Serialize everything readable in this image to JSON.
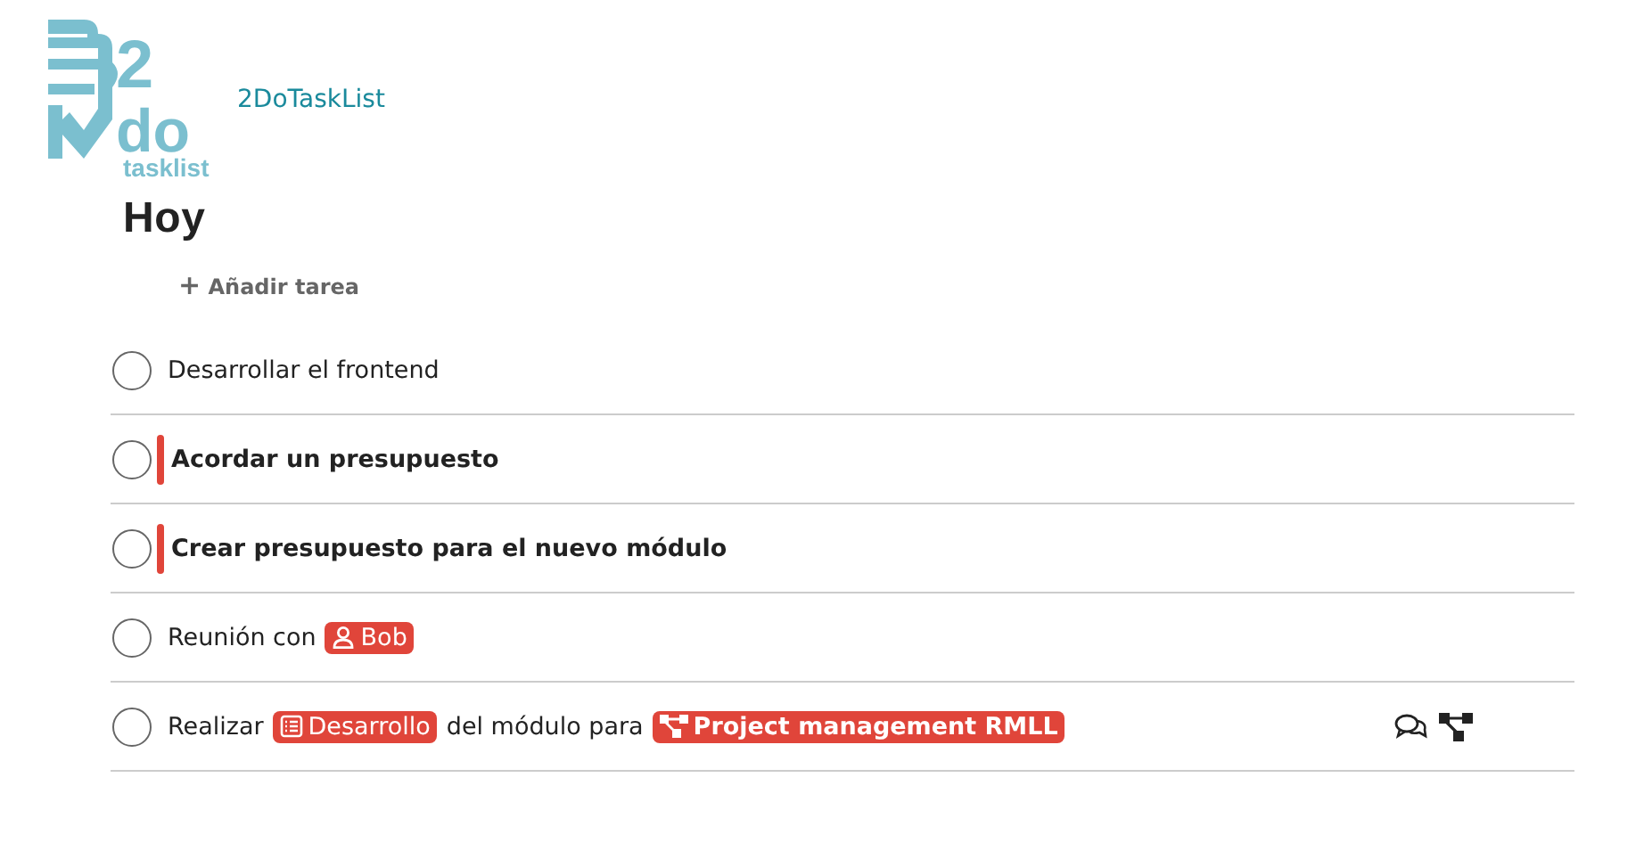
{
  "logo": {
    "numeral": "2",
    "word": "do",
    "caption": "tasklist"
  },
  "app_name": "2DoTaskList",
  "heading": "Hoy",
  "add_task": {
    "icon": "+",
    "label": "Añadir tarea"
  },
  "tasks": [
    {
      "checked": false,
      "priority": false,
      "comments": false,
      "subtasks": false,
      "parts": [
        {
          "kind": "text",
          "text": "Desarrollar el frontend"
        }
      ]
    },
    {
      "checked": false,
      "priority": true,
      "comments": false,
      "subtasks": false,
      "parts": [
        {
          "kind": "text",
          "text": "Acordar un presupuesto"
        }
      ]
    },
    {
      "checked": false,
      "priority": true,
      "comments": false,
      "subtasks": false,
      "parts": [
        {
          "kind": "text",
          "text": "Crear presupuesto para el nuevo módulo"
        }
      ]
    },
    {
      "checked": false,
      "priority": false,
      "comments": false,
      "subtasks": false,
      "parts": [
        {
          "kind": "text",
          "text": "Reunión con"
        },
        {
          "kind": "person",
          "text": "Bob"
        }
      ]
    },
    {
      "checked": false,
      "priority": false,
      "comments": true,
      "subtasks": true,
      "parts": [
        {
          "kind": "text",
          "text": "Realizar"
        },
        {
          "kind": "list",
          "text": "Desarrollo"
        },
        {
          "kind": "text",
          "text": "del módulo para"
        },
        {
          "kind": "project",
          "text": "Project management RMLL"
        }
      ]
    }
  ]
}
